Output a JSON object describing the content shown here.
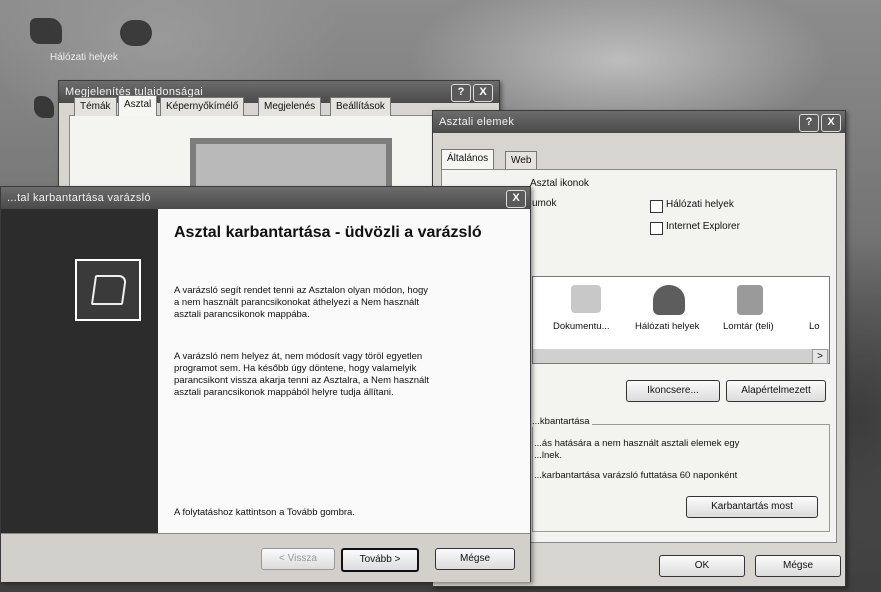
{
  "desktop": {
    "icons": [
      {
        "label": "Hálózati helyek"
      },
      {
        "label": ""
      },
      {
        "label": ""
      }
    ]
  },
  "display_props": {
    "title": "Megjelenítés tulajdonságai",
    "title_buttons": [
      "?",
      "X"
    ],
    "tabs": [
      "Témák",
      "Asztal",
      "Képernyőkímélő",
      "Megjelenés",
      "Beállítások"
    ],
    "active_tab": "Asztal"
  },
  "desktop_items": {
    "title": "Asztali elemek",
    "title_buttons": [
      "?",
      "X"
    ],
    "tabs": [
      "Általános",
      "Web"
    ],
    "icons_group_label": "Asztal ikonok",
    "partial_label": "umok",
    "checkboxes": [
      {
        "label": "Hálózati helyek",
        "checked": false
      },
      {
        "label": "Internet Explorer",
        "checked": false
      }
    ],
    "icon_list": [
      "Dokumentu...",
      "Hálózati helyek",
      "Lomtár (teli)",
      "Lo"
    ],
    "scroll_right": ">",
    "change_icon_button": "Ikoncsere...",
    "default_button": "Alapértelmezett",
    "cleanup_group_label": "...kbantartása",
    "cleanup_text": "...ás hatására a nem használt asztali elemek egy\n...lnek.",
    "cleanup_checkbox_label": "...karbantartása varázsló futtatása 60 naponként",
    "cleanup_now_button": "Karbantartás most",
    "ok_button": "OK",
    "cancel_button": "Mégse"
  },
  "wizard": {
    "title": "...tal karbantartása varázsló",
    "close_button": "X",
    "heading": "Asztal karbantartása - üdvözli a varázsló",
    "para1": "A varázsló segít rendet tenni az Asztalon olyan módon, hogy\na nem használt parancsikonokat áthelyezi a Nem használt\nasztali parancsikonok mappába.",
    "para2": "A varázsló nem helyez át, nem módosít vagy töröl egyetlen\nprogramot sem. Ha később úgy döntene, hogy valamelyik\nparancsikont vissza akarja tenni az Asztalra, a Nem használt\nasztali parancsikonok mappából helyre tudja állítani.",
    "para3": "A folytatáshoz kattintson a Tovább gombra.",
    "back_button": "< Vissza",
    "next_button": "Tovább >",
    "cancel_button": "Mégse"
  }
}
